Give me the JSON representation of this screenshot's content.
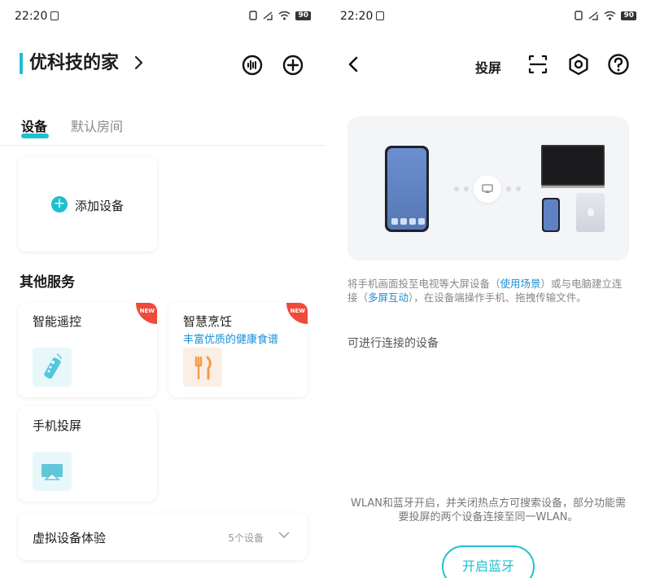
{
  "left": {
    "status": {
      "time": "22:20",
      "battery": "90"
    },
    "home_title": "优科技的家",
    "tabs": [
      "设备",
      "默认房间"
    ],
    "add_device_label": "添加设备",
    "section_title": "其他服务",
    "services": [
      {
        "name": "智能遥控",
        "subtitle": "",
        "badge": "NEW"
      },
      {
        "name": "智慧烹饪",
        "subtitle": "丰富优质的健康食谱",
        "badge": "NEW"
      },
      {
        "name": "手机投屏",
        "subtitle": "",
        "badge": ""
      }
    ],
    "virtual": {
      "label": "虚拟设备体验",
      "count": "5个设备"
    }
  },
  "right": {
    "status": {
      "time": "22:20",
      "battery": "90"
    },
    "title": "投屏",
    "desc_part1": "将手机画面投至电视等大屏设备（",
    "desc_link1": "使用场景",
    "desc_part2": "）或与电脑建立连接（",
    "desc_link2": "多屏互动",
    "desc_part3": "），在设备端操作手机、拖拽传输文件。",
    "connect_title": "可进行连接的设备",
    "hint": "WLAN和蓝牙开启，并关闭热点方可搜索设备，部分功能需要投屏的两个设备连接至同一WLAN。",
    "bt_button": "开启蓝牙"
  },
  "colors": {
    "accent": "#1ec0cf",
    "link": "#1a8fd6",
    "badge": "#f04a3a"
  }
}
